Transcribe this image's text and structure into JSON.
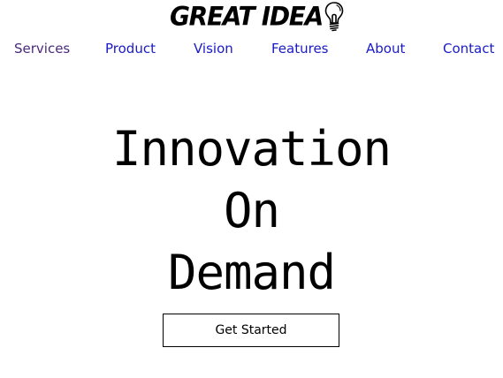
{
  "logo": {
    "text": "GREAT IDEA",
    "icon": "lightbulb-icon"
  },
  "nav": {
    "items": [
      {
        "label": "Services",
        "visited": true
      },
      {
        "label": "Product",
        "visited": false
      },
      {
        "label": "Vision",
        "visited": false
      },
      {
        "label": "Features",
        "visited": false
      },
      {
        "label": "About",
        "visited": false
      },
      {
        "label": "Contact",
        "visited": false
      }
    ]
  },
  "hero": {
    "lines": [
      "Innovation",
      "On",
      "Demand"
    ]
  },
  "cta": {
    "label": "Get Started"
  },
  "colors": {
    "link": "#1a1ac8",
    "visited_link": "#4b2a7d",
    "text": "#000000",
    "background": "#ffffff"
  }
}
